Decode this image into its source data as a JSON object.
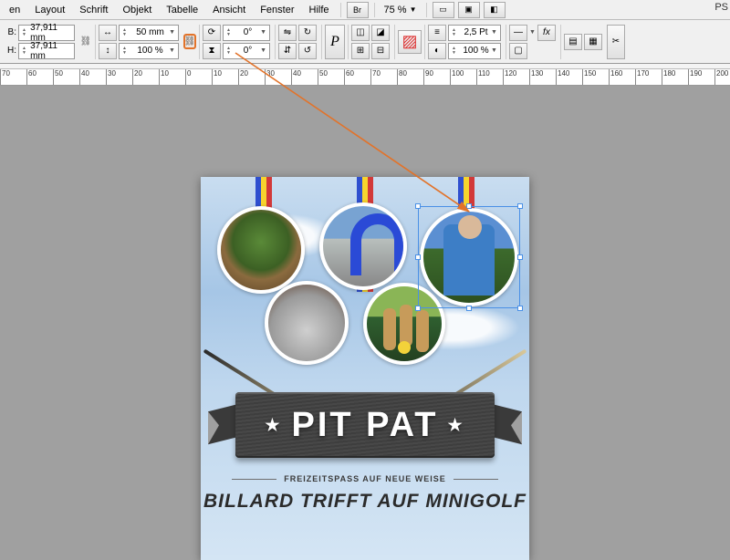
{
  "menu": {
    "items": [
      "en",
      "Layout",
      "Schrift",
      "Objekt",
      "Tabelle",
      "Ansicht",
      "Fenster",
      "Hilfe"
    ],
    "br": "Br",
    "zoom": "75 %",
    "ps": "PS"
  },
  "tb": {
    "B_label": "B:",
    "B_value": "37,911 mm",
    "H_label": "H:",
    "H_value": "37,911 mm",
    "size_value": "50 mm",
    "scale_value": "100 %",
    "rot1": "0°",
    "rot2": "0°",
    "stroke_value": "2,5 Pt",
    "opacity_value": "100 %"
  },
  "ruler": [
    "70",
    "60",
    "50",
    "40",
    "30",
    "20",
    "10",
    "0",
    "10",
    "20",
    "30",
    "40",
    "50",
    "60",
    "70",
    "80",
    "90",
    "100",
    "110",
    "120",
    "130",
    "140",
    "150",
    "160",
    "170",
    "180",
    "190",
    "200"
  ],
  "flyer": {
    "title": "PIT PAT",
    "tagline": "FREIZEITSPASS AUF NEUE WEISE",
    "subtitle": "BILLARD TRIFFT AUF MINIGOLF"
  }
}
